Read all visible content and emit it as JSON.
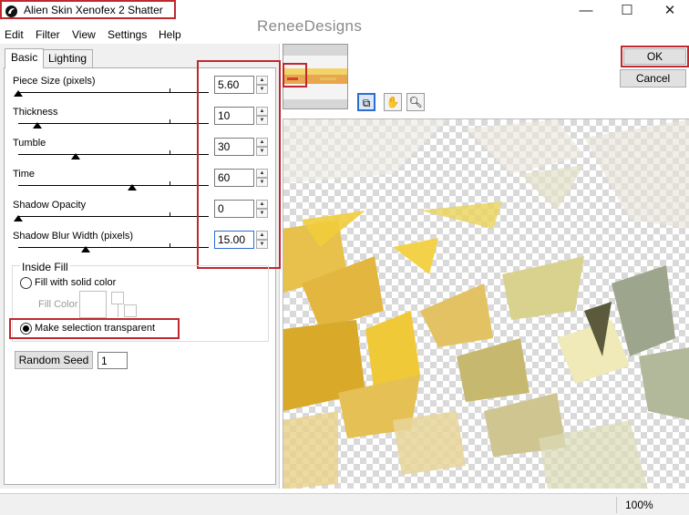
{
  "window": {
    "title": "Alien Skin Xenofex 2 Shatter",
    "watermark": "ReneeDesigns",
    "controls": {
      "minimize": "—",
      "maximize": "☐",
      "close": "✕"
    }
  },
  "menu": [
    "Edit",
    "Filter",
    "View",
    "Settings",
    "Help"
  ],
  "tabs": [
    {
      "label": "Basic",
      "active": true
    },
    {
      "label": "Lighting",
      "active": false
    }
  ],
  "params": [
    {
      "label": "Piece Size (pixels)",
      "value": "5.60"
    },
    {
      "label": "Thickness",
      "value": "10"
    },
    {
      "label": "Tumble",
      "value": "30"
    },
    {
      "label": "Time",
      "value": "60"
    },
    {
      "label": "Shadow Opacity",
      "value": "0"
    },
    {
      "label": "Shadow Blur Width (pixels)",
      "value": "15.00"
    }
  ],
  "inside_fill": {
    "group_label": "Inside Fill",
    "option_solid": "Fill with solid color",
    "fill_color_label": "Fill Color",
    "option_transparent": "Make selection transparent",
    "selected": "transparent"
  },
  "random_seed": {
    "label": "Random Seed",
    "value": "1"
  },
  "buttons": {
    "ok": "OK",
    "cancel": "Cancel"
  },
  "tools": [
    "preview-toggle-icon",
    "hand-icon",
    "zoom-icon"
  ],
  "status": {
    "zoom": "100%"
  },
  "colors": {
    "highlight": "#c0282d",
    "accent": "#2a6fd0"
  }
}
